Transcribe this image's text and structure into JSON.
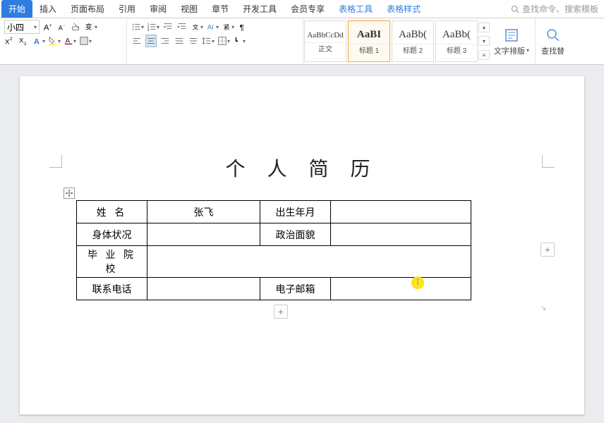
{
  "tabs": {
    "t0": "开始",
    "t1": "插入",
    "t2": "页面布局",
    "t3": "引用",
    "t4": "审阅",
    "t5": "视图",
    "t6": "章节",
    "t7": "开发工具",
    "t8": "会员专享",
    "t9": "表格工具",
    "t10": "表格样式"
  },
  "search_placeholder": "查找命令、搜索模板",
  "font_size": "小四",
  "styles": {
    "s0_preview": "AaBbCcDd",
    "s0_label": "正文",
    "s1_preview": "AaBI",
    "s1_label": "标题 1",
    "s2_preview": "AaBb(",
    "s2_label": "标题 2",
    "s3_preview": "AaBb(",
    "s3_label": "标题 3"
  },
  "text_layout_label": "文字排版",
  "find_label": "查找替",
  "document": {
    "title": "个 人 简 历",
    "r0c0": "姓 名",
    "r0c1": "张飞",
    "r0c2": "出生年月",
    "r0c3": "",
    "r1c0": "身体状况",
    "r1c1": "",
    "r1c2": "政治面貌",
    "r1c3": "",
    "r2c0": "毕 业 院 校",
    "r2c1": "",
    "r3c0": "联系电话",
    "r3c1": "",
    "r3c2": "电子邮箱",
    "r3c3": ""
  }
}
